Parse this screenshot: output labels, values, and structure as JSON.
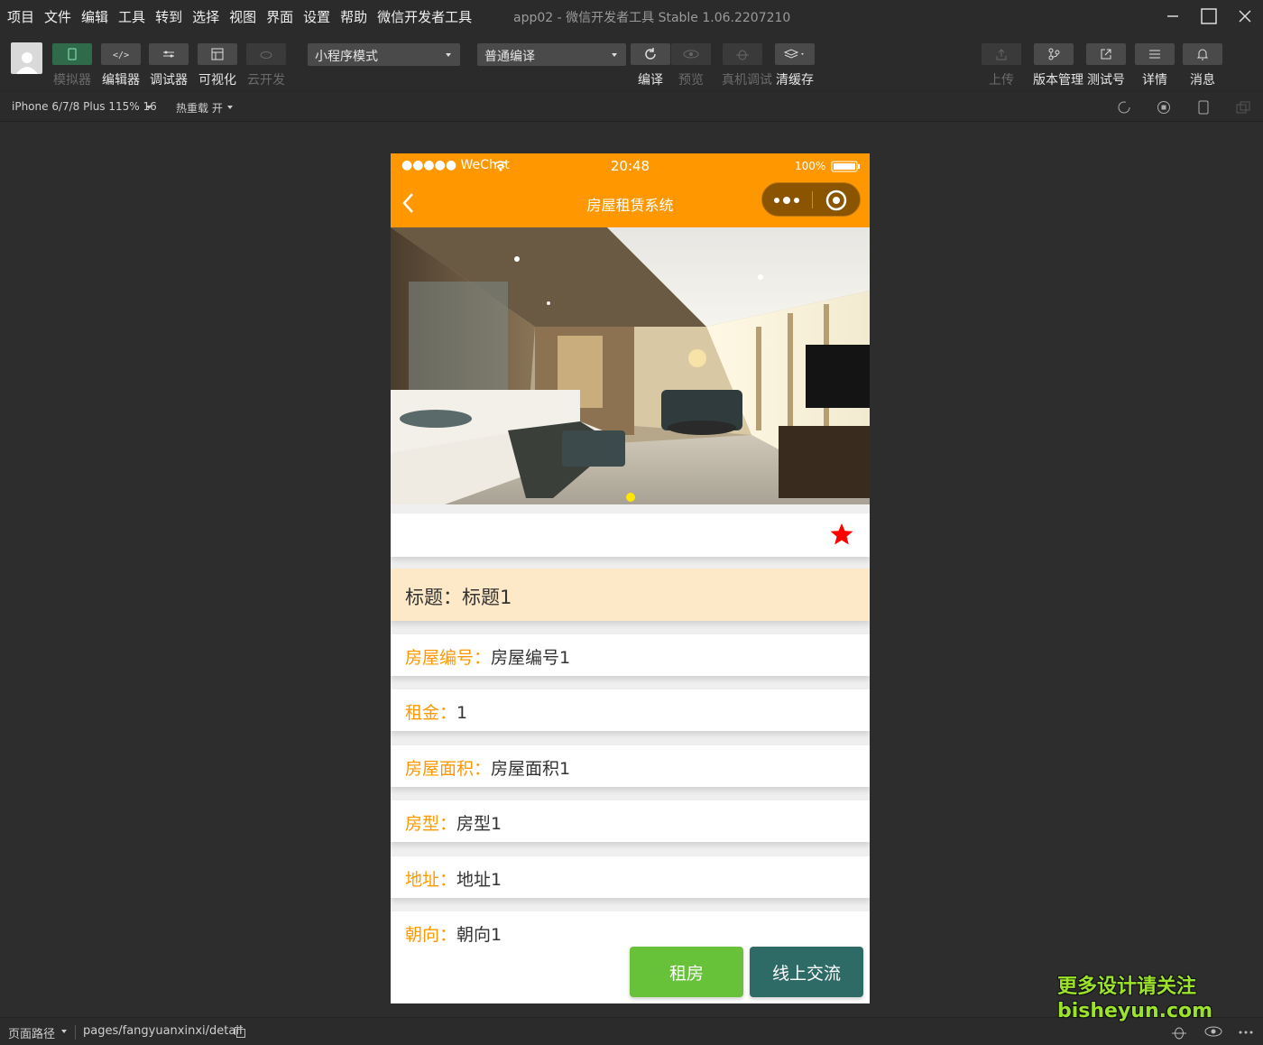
{
  "menu": [
    "项目",
    "文件",
    "编辑",
    "工具",
    "转到",
    "选择",
    "视图",
    "界面",
    "设置",
    "帮助",
    "微信开发者工具"
  ],
  "window_title": "app02 - 微信开发者工具 Stable 1.06.2207210",
  "toolbar": {
    "simulator": "模拟器",
    "editor": "编辑器",
    "debugger": "调试器",
    "visual": "可视化",
    "cloud": "云开发",
    "mode": "小程序模式",
    "compile_mode": "普通编译",
    "compile": "编译",
    "preview": "预览",
    "real_debug": "真机调试",
    "clear_cache": "清缓存",
    "upload": "上传",
    "version": "版本管理",
    "test_account": "测试号",
    "details": "详情",
    "messages": "消息"
  },
  "subbar": {
    "device": "iPhone 6/7/8 Plus 115% 16",
    "hot_reload": "热重载 开"
  },
  "phone": {
    "status": {
      "carrier": "●●●●● WeChat",
      "time": "20:48",
      "battery": "100%"
    },
    "nav_title": "房屋租赁系统",
    "title_row": {
      "label": "标题：",
      "value": "标题1"
    },
    "fields": [
      {
        "label": "房屋编号：",
        "value": "房屋编号1"
      },
      {
        "label": "租金：",
        "value": "1"
      },
      {
        "label": "房屋面积：",
        "value": "房屋面积1"
      },
      {
        "label": "房型：",
        "value": "房型1"
      },
      {
        "label": "地址：",
        "value": "地址1"
      },
      {
        "label": "朝向：",
        "value": "朝向1"
      }
    ],
    "rent_button": "租房",
    "chat_button": "线上交流"
  },
  "bottombar": {
    "path_label": "页面路径",
    "path": "pages/fangyuanxinxi/detail"
  },
  "watermark": {
    "line1": "更多设计请关注",
    "line2": "bisheyun.com"
  },
  "colors": {
    "accent": "#ff9800",
    "rent": "#67c23a",
    "chat": "#2e6b66",
    "star": "#ff0000",
    "title_bg": "#fde8c8"
  }
}
